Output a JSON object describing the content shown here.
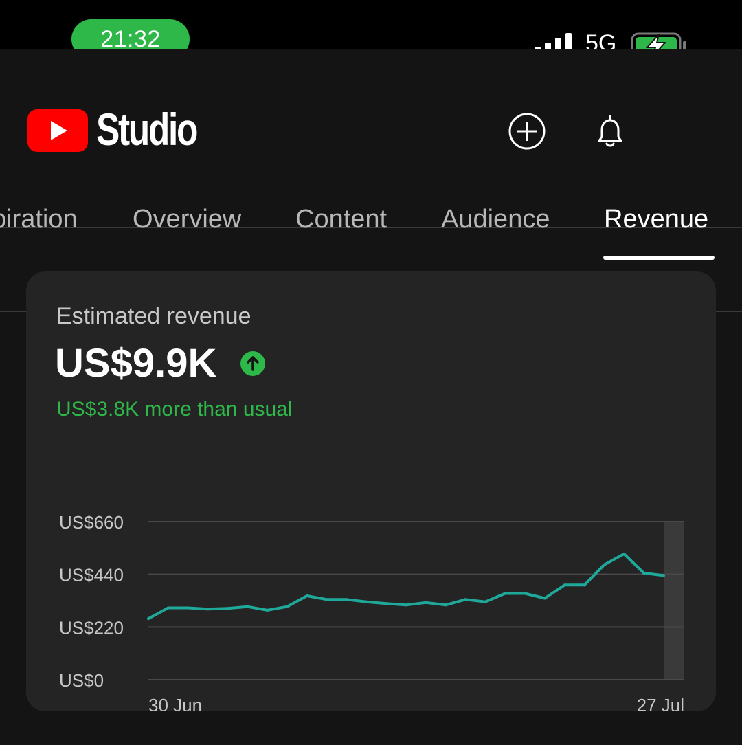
{
  "status_bar": {
    "time": "21:32",
    "network": "5G"
  },
  "header": {
    "brand": "Studio"
  },
  "tabs": [
    {
      "label": "piration"
    },
    {
      "label": "Overview"
    },
    {
      "label": "Content"
    },
    {
      "label": "Audience"
    },
    {
      "label": "Revenue",
      "active": true
    }
  ],
  "card": {
    "title": "Estimated revenue",
    "value": "US$9.9K",
    "subtitle": "US$3.8K more than usual"
  },
  "colors": {
    "accent_green": "#2fb84a",
    "line": "#1fa99a",
    "brand_red": "#ff0000"
  },
  "chart_data": {
    "type": "line",
    "x_tick_labels": [
      "30 Jun",
      "27 Jul"
    ],
    "y_tick_labels": [
      "US$660",
      "US$440",
      "US$220",
      "US$0"
    ],
    "y_ticks": [
      660,
      440,
      220,
      0
    ],
    "ylim": [
      0,
      660
    ],
    "grid": true,
    "series": [
      {
        "values": [
          255,
          300,
          300,
          295,
          298,
          305,
          290,
          305,
          350,
          335,
          335,
          325,
          318,
          312,
          322,
          312,
          335,
          325,
          360,
          360,
          340,
          395,
          395,
          480,
          525,
          445,
          435
        ]
      }
    ]
  }
}
